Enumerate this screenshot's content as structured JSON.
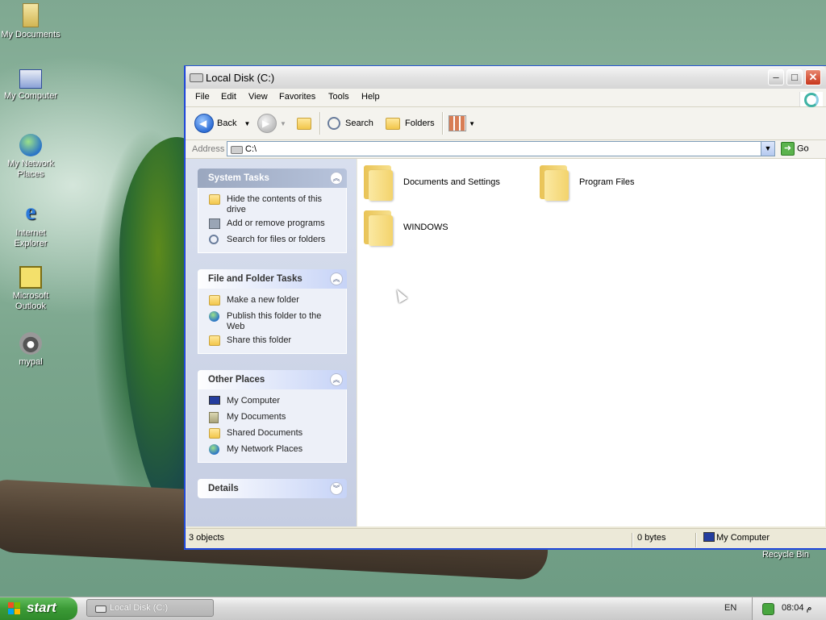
{
  "desktop": {
    "icons": [
      {
        "label": "My Documents",
        "icon": "my-documents-icon"
      },
      {
        "label": "My Computer",
        "icon": "my-computer-icon"
      },
      {
        "label": "My Network Places",
        "icon": "network-places-icon"
      },
      {
        "label": "Internet Explorer",
        "icon": "internet-explorer-icon"
      },
      {
        "label": "Microsoft Outlook",
        "icon": "outlook-icon"
      },
      {
        "label": "mypal",
        "icon": "mypal-icon"
      },
      {
        "label": "Recycle Bin",
        "icon": "recycle-bin-icon"
      }
    ]
  },
  "window": {
    "title": "Local Disk (C:)",
    "menu": [
      "File",
      "Edit",
      "View",
      "Favorites",
      "Tools",
      "Help"
    ],
    "toolbar": {
      "back": "Back",
      "search": "Search",
      "folders": "Folders"
    },
    "address": {
      "label": "Address",
      "value": "C:\\",
      "go": "Go"
    },
    "panels": {
      "system_tasks": {
        "title": "System Tasks",
        "items": [
          "Hide the contents of this drive",
          "Add or remove programs",
          "Search for files or folders"
        ]
      },
      "file_folder_tasks": {
        "title": "File and Folder Tasks",
        "items": [
          "Make a new folder",
          "Publish this folder to the Web",
          "Share this folder"
        ]
      },
      "other_places": {
        "title": "Other Places",
        "items": [
          "My Computer",
          "My Documents",
          "Shared Documents",
          "My Network Places"
        ]
      },
      "details": {
        "title": "Details"
      }
    },
    "folders": [
      "Documents and Settings",
      "Program Files",
      "WINDOWS"
    ],
    "status": {
      "objects": "3 objects",
      "size": "0 bytes",
      "location": "My Computer"
    }
  },
  "taskbar": {
    "start": "start",
    "task": "Local Disk (C:)",
    "language": "EN",
    "clock": "م 08:04"
  },
  "colors": {
    "accent": "#215dc6",
    "start": "#3b9a36",
    "close": "#c7361b"
  }
}
